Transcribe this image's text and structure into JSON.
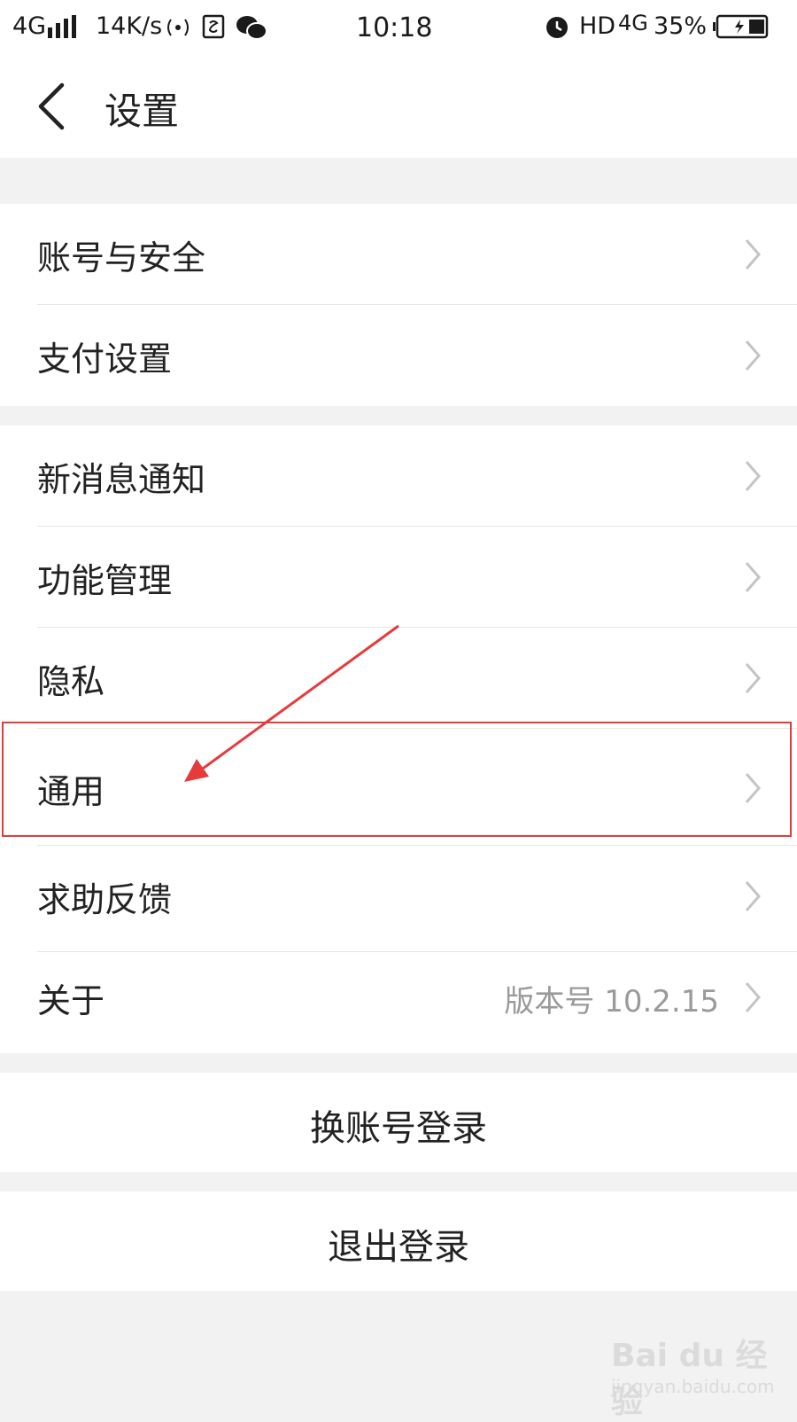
{
  "status_bar": {
    "network": "4G",
    "speed": "14K/s",
    "time": "10:18",
    "hd": "HD",
    "network_right": "4G",
    "battery": "35%"
  },
  "header": {
    "title": "设置"
  },
  "groups": [
    {
      "items": [
        {
          "label": "账号与安全"
        },
        {
          "label": "支付设置"
        }
      ]
    },
    {
      "items": [
        {
          "label": "新消息通知"
        },
        {
          "label": "功能管理"
        },
        {
          "label": "隐私"
        },
        {
          "label": "通用"
        },
        {
          "label": "求助反馈"
        },
        {
          "label": "关于",
          "value": "版本号 10.2.15"
        }
      ]
    }
  ],
  "actions": {
    "switch_account": "换账号登录",
    "logout": "退出登录"
  },
  "annotation": {
    "highlight_color": "#e53b3b"
  },
  "watermark": {
    "main": "Bai du 经验",
    "sub": "jingyan.baidu.com"
  }
}
